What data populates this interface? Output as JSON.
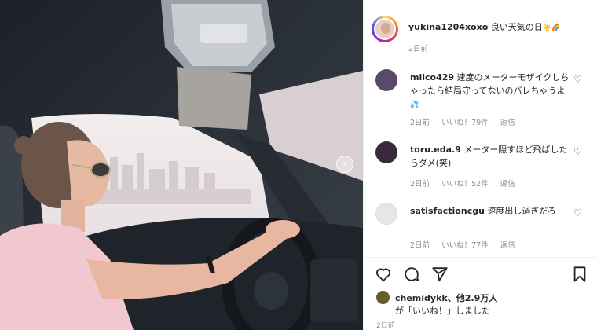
{
  "post": {
    "username": "yukina1204xoxo",
    "caption": "良い天気の日",
    "caption_emoji": "☀️🌈",
    "time_ago": "2日前"
  },
  "comments": [
    {
      "username": "miico429",
      "text": "速度のメーターモザイクしちゃったら結局守ってないのバレちゃうよ",
      "emoji": "💦",
      "time_ago": "2日前",
      "likes": "いいね！79件",
      "reply": "返信",
      "avatar_color": "#5a4a6a"
    },
    {
      "username": "toru.eda.9",
      "text": "メーター隠すほど飛ばしたらダメ(笑)",
      "emoji": "",
      "time_ago": "2日前",
      "likes": "いいね！52件",
      "reply": "返信",
      "avatar_color": "#3a2a3e"
    },
    {
      "username": "satisfactioncgu",
      "text": "速度出し過ぎだろ",
      "emoji": "",
      "time_ago": "2日前",
      "likes": "いいね！77件",
      "reply": "返信",
      "avatar_color": "#dbdbdb"
    }
  ],
  "likes_summary": {
    "first_liker": "chemidykk",
    "others": "、他2.9万人",
    "suffix": "が「いいね！」しました"
  },
  "footer_time": "2日前",
  "icons": {
    "like": "heart-outline-icon",
    "comment": "comment-bubble-icon",
    "share": "paper-plane-icon",
    "save": "bookmark-icon",
    "carousel": "chevron-right-icon"
  },
  "colors": {
    "text": "#262626",
    "secondary": "#8e8e8e",
    "border": "#efefef"
  }
}
